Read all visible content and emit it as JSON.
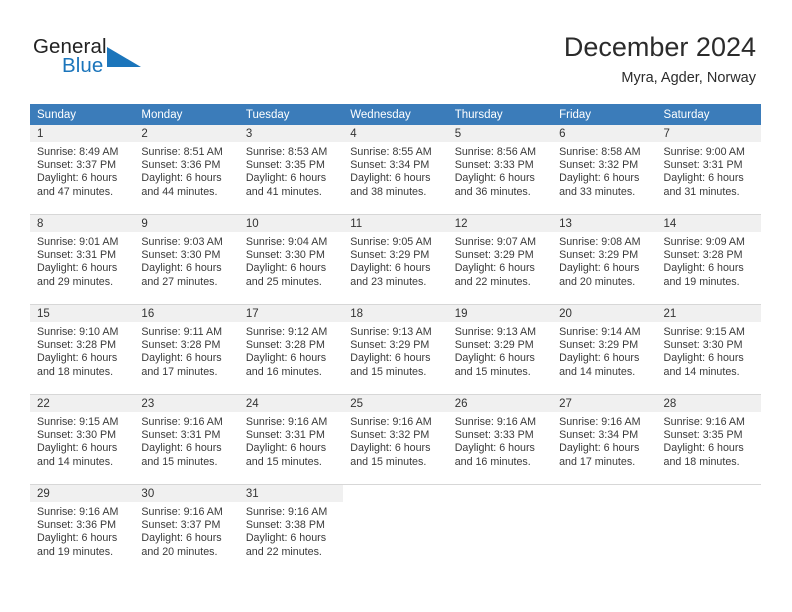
{
  "brand": {
    "word_one": "General",
    "word_two": "Blue",
    "logo_icon": "triangle-flag-icon",
    "accent_color": "#1b75bb"
  },
  "header": {
    "title": "December 2024",
    "subtitle": "Myra, Agder, Norway"
  },
  "calendar": {
    "header_color": "#3b7cba",
    "daynum_row_color": "#f0f0f0",
    "weekday_headers": [
      "Sunday",
      "Monday",
      "Tuesday",
      "Wednesday",
      "Thursday",
      "Friday",
      "Saturday"
    ],
    "weeks": [
      [
        {
          "day": "1",
          "detail": "Sunrise: 8:49 AM\nSunset: 3:37 PM\nDaylight: 6 hours\nand 47 minutes."
        },
        {
          "day": "2",
          "detail": "Sunrise: 8:51 AM\nSunset: 3:36 PM\nDaylight: 6 hours\nand 44 minutes."
        },
        {
          "day": "3",
          "detail": "Sunrise: 8:53 AM\nSunset: 3:35 PM\nDaylight: 6 hours\nand 41 minutes."
        },
        {
          "day": "4",
          "detail": "Sunrise: 8:55 AM\nSunset: 3:34 PM\nDaylight: 6 hours\nand 38 minutes."
        },
        {
          "day": "5",
          "detail": "Sunrise: 8:56 AM\nSunset: 3:33 PM\nDaylight: 6 hours\nand 36 minutes."
        },
        {
          "day": "6",
          "detail": "Sunrise: 8:58 AM\nSunset: 3:32 PM\nDaylight: 6 hours\nand 33 minutes."
        },
        {
          "day": "7",
          "detail": "Sunrise: 9:00 AM\nSunset: 3:31 PM\nDaylight: 6 hours\nand 31 minutes."
        }
      ],
      [
        {
          "day": "8",
          "detail": "Sunrise: 9:01 AM\nSunset: 3:31 PM\nDaylight: 6 hours\nand 29 minutes."
        },
        {
          "day": "9",
          "detail": "Sunrise: 9:03 AM\nSunset: 3:30 PM\nDaylight: 6 hours\nand 27 minutes."
        },
        {
          "day": "10",
          "detail": "Sunrise: 9:04 AM\nSunset: 3:30 PM\nDaylight: 6 hours\nand 25 minutes."
        },
        {
          "day": "11",
          "detail": "Sunrise: 9:05 AM\nSunset: 3:29 PM\nDaylight: 6 hours\nand 23 minutes."
        },
        {
          "day": "12",
          "detail": "Sunrise: 9:07 AM\nSunset: 3:29 PM\nDaylight: 6 hours\nand 22 minutes."
        },
        {
          "day": "13",
          "detail": "Sunrise: 9:08 AM\nSunset: 3:29 PM\nDaylight: 6 hours\nand 20 minutes."
        },
        {
          "day": "14",
          "detail": "Sunrise: 9:09 AM\nSunset: 3:28 PM\nDaylight: 6 hours\nand 19 minutes."
        }
      ],
      [
        {
          "day": "15",
          "detail": "Sunrise: 9:10 AM\nSunset: 3:28 PM\nDaylight: 6 hours\nand 18 minutes."
        },
        {
          "day": "16",
          "detail": "Sunrise: 9:11 AM\nSunset: 3:28 PM\nDaylight: 6 hours\nand 17 minutes."
        },
        {
          "day": "17",
          "detail": "Sunrise: 9:12 AM\nSunset: 3:28 PM\nDaylight: 6 hours\nand 16 minutes."
        },
        {
          "day": "18",
          "detail": "Sunrise: 9:13 AM\nSunset: 3:29 PM\nDaylight: 6 hours\nand 15 minutes."
        },
        {
          "day": "19",
          "detail": "Sunrise: 9:13 AM\nSunset: 3:29 PM\nDaylight: 6 hours\nand 15 minutes."
        },
        {
          "day": "20",
          "detail": "Sunrise: 9:14 AM\nSunset: 3:29 PM\nDaylight: 6 hours\nand 14 minutes."
        },
        {
          "day": "21",
          "detail": "Sunrise: 9:15 AM\nSunset: 3:30 PM\nDaylight: 6 hours\nand 14 minutes."
        }
      ],
      [
        {
          "day": "22",
          "detail": "Sunrise: 9:15 AM\nSunset: 3:30 PM\nDaylight: 6 hours\nand 14 minutes."
        },
        {
          "day": "23",
          "detail": "Sunrise: 9:16 AM\nSunset: 3:31 PM\nDaylight: 6 hours\nand 15 minutes."
        },
        {
          "day": "24",
          "detail": "Sunrise: 9:16 AM\nSunset: 3:31 PM\nDaylight: 6 hours\nand 15 minutes."
        },
        {
          "day": "25",
          "detail": "Sunrise: 9:16 AM\nSunset: 3:32 PM\nDaylight: 6 hours\nand 15 minutes."
        },
        {
          "day": "26",
          "detail": "Sunrise: 9:16 AM\nSunset: 3:33 PM\nDaylight: 6 hours\nand 16 minutes."
        },
        {
          "day": "27",
          "detail": "Sunrise: 9:16 AM\nSunset: 3:34 PM\nDaylight: 6 hours\nand 17 minutes."
        },
        {
          "day": "28",
          "detail": "Sunrise: 9:16 AM\nSunset: 3:35 PM\nDaylight: 6 hours\nand 18 minutes."
        }
      ],
      [
        {
          "day": "29",
          "detail": "Sunrise: 9:16 AM\nSunset: 3:36 PM\nDaylight: 6 hours\nand 19 minutes."
        },
        {
          "day": "30",
          "detail": "Sunrise: 9:16 AM\nSunset: 3:37 PM\nDaylight: 6 hours\nand 20 minutes."
        },
        {
          "day": "31",
          "detail": "Sunrise: 9:16 AM\nSunset: 3:38 PM\nDaylight: 6 hours\nand 22 minutes."
        },
        {
          "day": "",
          "detail": ""
        },
        {
          "day": "",
          "detail": ""
        },
        {
          "day": "",
          "detail": ""
        },
        {
          "day": "",
          "detail": ""
        }
      ]
    ]
  }
}
